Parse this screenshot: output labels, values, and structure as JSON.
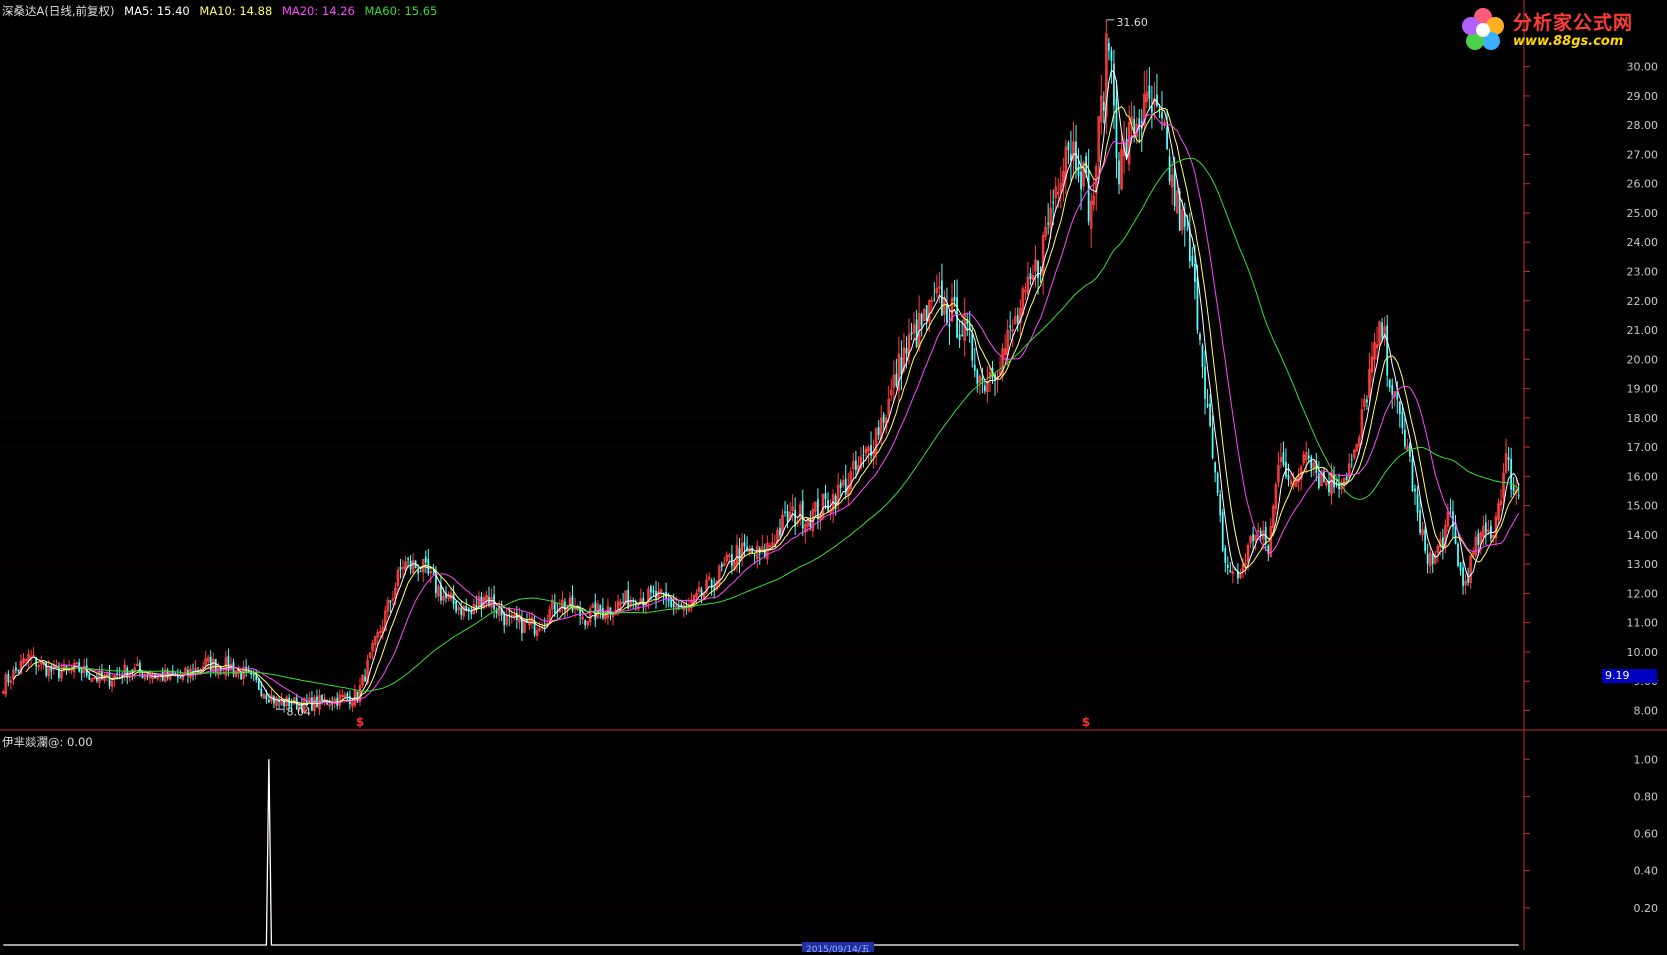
{
  "header": {
    "stock": "深桑达A",
    "mode": "(日线,前复权)",
    "ma": [
      {
        "label": "MA5:",
        "value": "15.40",
        "color": "#ffffff"
      },
      {
        "label": "MA10:",
        "value": "14.88",
        "color": "#ffff66"
      },
      {
        "label": "MA20:",
        "value": "14.26",
        "color": "#ff44ff"
      },
      {
        "label": "MA60:",
        "value": "15.65",
        "color": "#33dd33"
      }
    ]
  },
  "indicator": {
    "label": "伊芈燚瀾@",
    "value": ": 0.00"
  },
  "logo": {
    "name": "分析家公式网",
    "url": "www.88gs.com"
  },
  "price_tag": "9.19",
  "date_tag": "2015/09/14/五",
  "colors": {
    "up": "#ff4040",
    "down": "#54ffff",
    "ma5": "#ffffff",
    "ma10": "#ffff66",
    "ma20": "#ff44ff",
    "ma60": "#33dd33",
    "axis": "#c03030",
    "signal": "#ff3030"
  },
  "chart_data": [
    {
      "type": "candlestick",
      "ylim": [
        7.4,
        31.8
      ],
      "y_ticks": [
        "8.00",
        "9.00",
        "10.00",
        "11.00",
        "12.00",
        "13.00",
        "14.00",
        "15.00",
        "16.00",
        "17.00",
        "18.00",
        "19.00",
        "20.00",
        "21.00",
        "22.00",
        "23.00",
        "24.00",
        "25.00",
        "26.00",
        "27.00",
        "28.00",
        "29.00",
        "30.00"
      ],
      "annotations": [
        {
          "text": "31.60",
          "value": 31.6,
          "kind": "high"
        },
        {
          "text": "8.04",
          "value": 8.04,
          "kind": "low"
        }
      ],
      "signals": [
        {
          "text": "$",
          "at_bar": 141
        },
        {
          "text": "$",
          "at_bar": 428
        }
      ],
      "close_path": [
        [
          0,
          8.9
        ],
        [
          10,
          9.8
        ],
        [
          20,
          9.3
        ],
        [
          30,
          9.4
        ],
        [
          40,
          9.0
        ],
        [
          50,
          9.4
        ],
        [
          60,
          9.2
        ],
        [
          70,
          9.1
        ],
        [
          80,
          9.6
        ],
        [
          90,
          9.5
        ],
        [
          100,
          8.9
        ],
        [
          108,
          8.3
        ],
        [
          120,
          8.2
        ],
        [
          140,
          8.5
        ],
        [
          150,
          11.0
        ],
        [
          158,
          13.0
        ],
        [
          165,
          12.9
        ],
        [
          175,
          11.8
        ],
        [
          185,
          11.3
        ],
        [
          190,
          12.0
        ],
        [
          200,
          11.0
        ],
        [
          210,
          10.9
        ],
        [
          220,
          11.7
        ],
        [
          230,
          11.2
        ],
        [
          240,
          11.5
        ],
        [
          250,
          11.9
        ],
        [
          260,
          11.8
        ],
        [
          270,
          11.4
        ],
        [
          280,
          12.3
        ],
        [
          290,
          13.4
        ],
        [
          300,
          13.3
        ],
        [
          310,
          14.6
        ],
        [
          320,
          14.7
        ],
        [
          330,
          15.4
        ],
        [
          340,
          16.5
        ],
        [
          350,
          18.5
        ],
        [
          355,
          20.0
        ],
        [
          360,
          20.8
        ],
        [
          370,
          22.0
        ],
        [
          380,
          21.0
        ],
        [
          387,
          19.2
        ],
        [
          395,
          20.2
        ],
        [
          400,
          21.2
        ],
        [
          405,
          22.2
        ],
        [
          410,
          23.5
        ],
        [
          415,
          25.5
        ],
        [
          420,
          27.5
        ],
        [
          425,
          27.0
        ],
        [
          430,
          25.0
        ],
        [
          437,
          31.1
        ],
        [
          441,
          26.5
        ],
        [
          447,
          28.0
        ],
        [
          453,
          28.6
        ],
        [
          458,
          27.8
        ],
        [
          463,
          25.5
        ],
        [
          468,
          24.0
        ],
        [
          473,
          21.0
        ],
        [
          478,
          16.5
        ],
        [
          483,
          13.0
        ],
        [
          488,
          12.5
        ],
        [
          495,
          14.2
        ],
        [
          500,
          13.5
        ],
        [
          505,
          17.0
        ],
        [
          510,
          15.4
        ],
        [
          515,
          17.2
        ],
        [
          520,
          16.0
        ],
        [
          525,
          15.8
        ],
        [
          530,
          16.0
        ],
        [
          535,
          16.8
        ],
        [
          540,
          19.5
        ],
        [
          545,
          21.0
        ],
        [
          550,
          18.5
        ],
        [
          555,
          17.0
        ],
        [
          560,
          14.0
        ],
        [
          565,
          13.0
        ],
        [
          572,
          14.6
        ],
        [
          577,
          12.2
        ],
        [
          583,
          13.8
        ],
        [
          589,
          14.2
        ],
        [
          594,
          16.5
        ],
        [
          598,
          15.4
        ]
      ],
      "series": [
        {
          "name": "MA5",
          "color": "#ffffff",
          "window": 5
        },
        {
          "name": "MA10",
          "color": "#ffff66",
          "window": 10
        },
        {
          "name": "MA20",
          "color": "#ff44ff",
          "window": 20
        },
        {
          "name": "MA60",
          "color": "#33dd33",
          "window": 60
        }
      ]
    },
    {
      "type": "line",
      "ylim": [
        0,
        1.05
      ],
      "y_ticks": [
        "0.20",
        "0.40",
        "0.60",
        "0.80",
        "1.00"
      ],
      "series": [
        {
          "name": "伊芈燚瀾@",
          "color": "#ffffff",
          "spike_at_bar": 105,
          "spike_value": 1.0,
          "base_value": 0.0
        }
      ]
    }
  ]
}
